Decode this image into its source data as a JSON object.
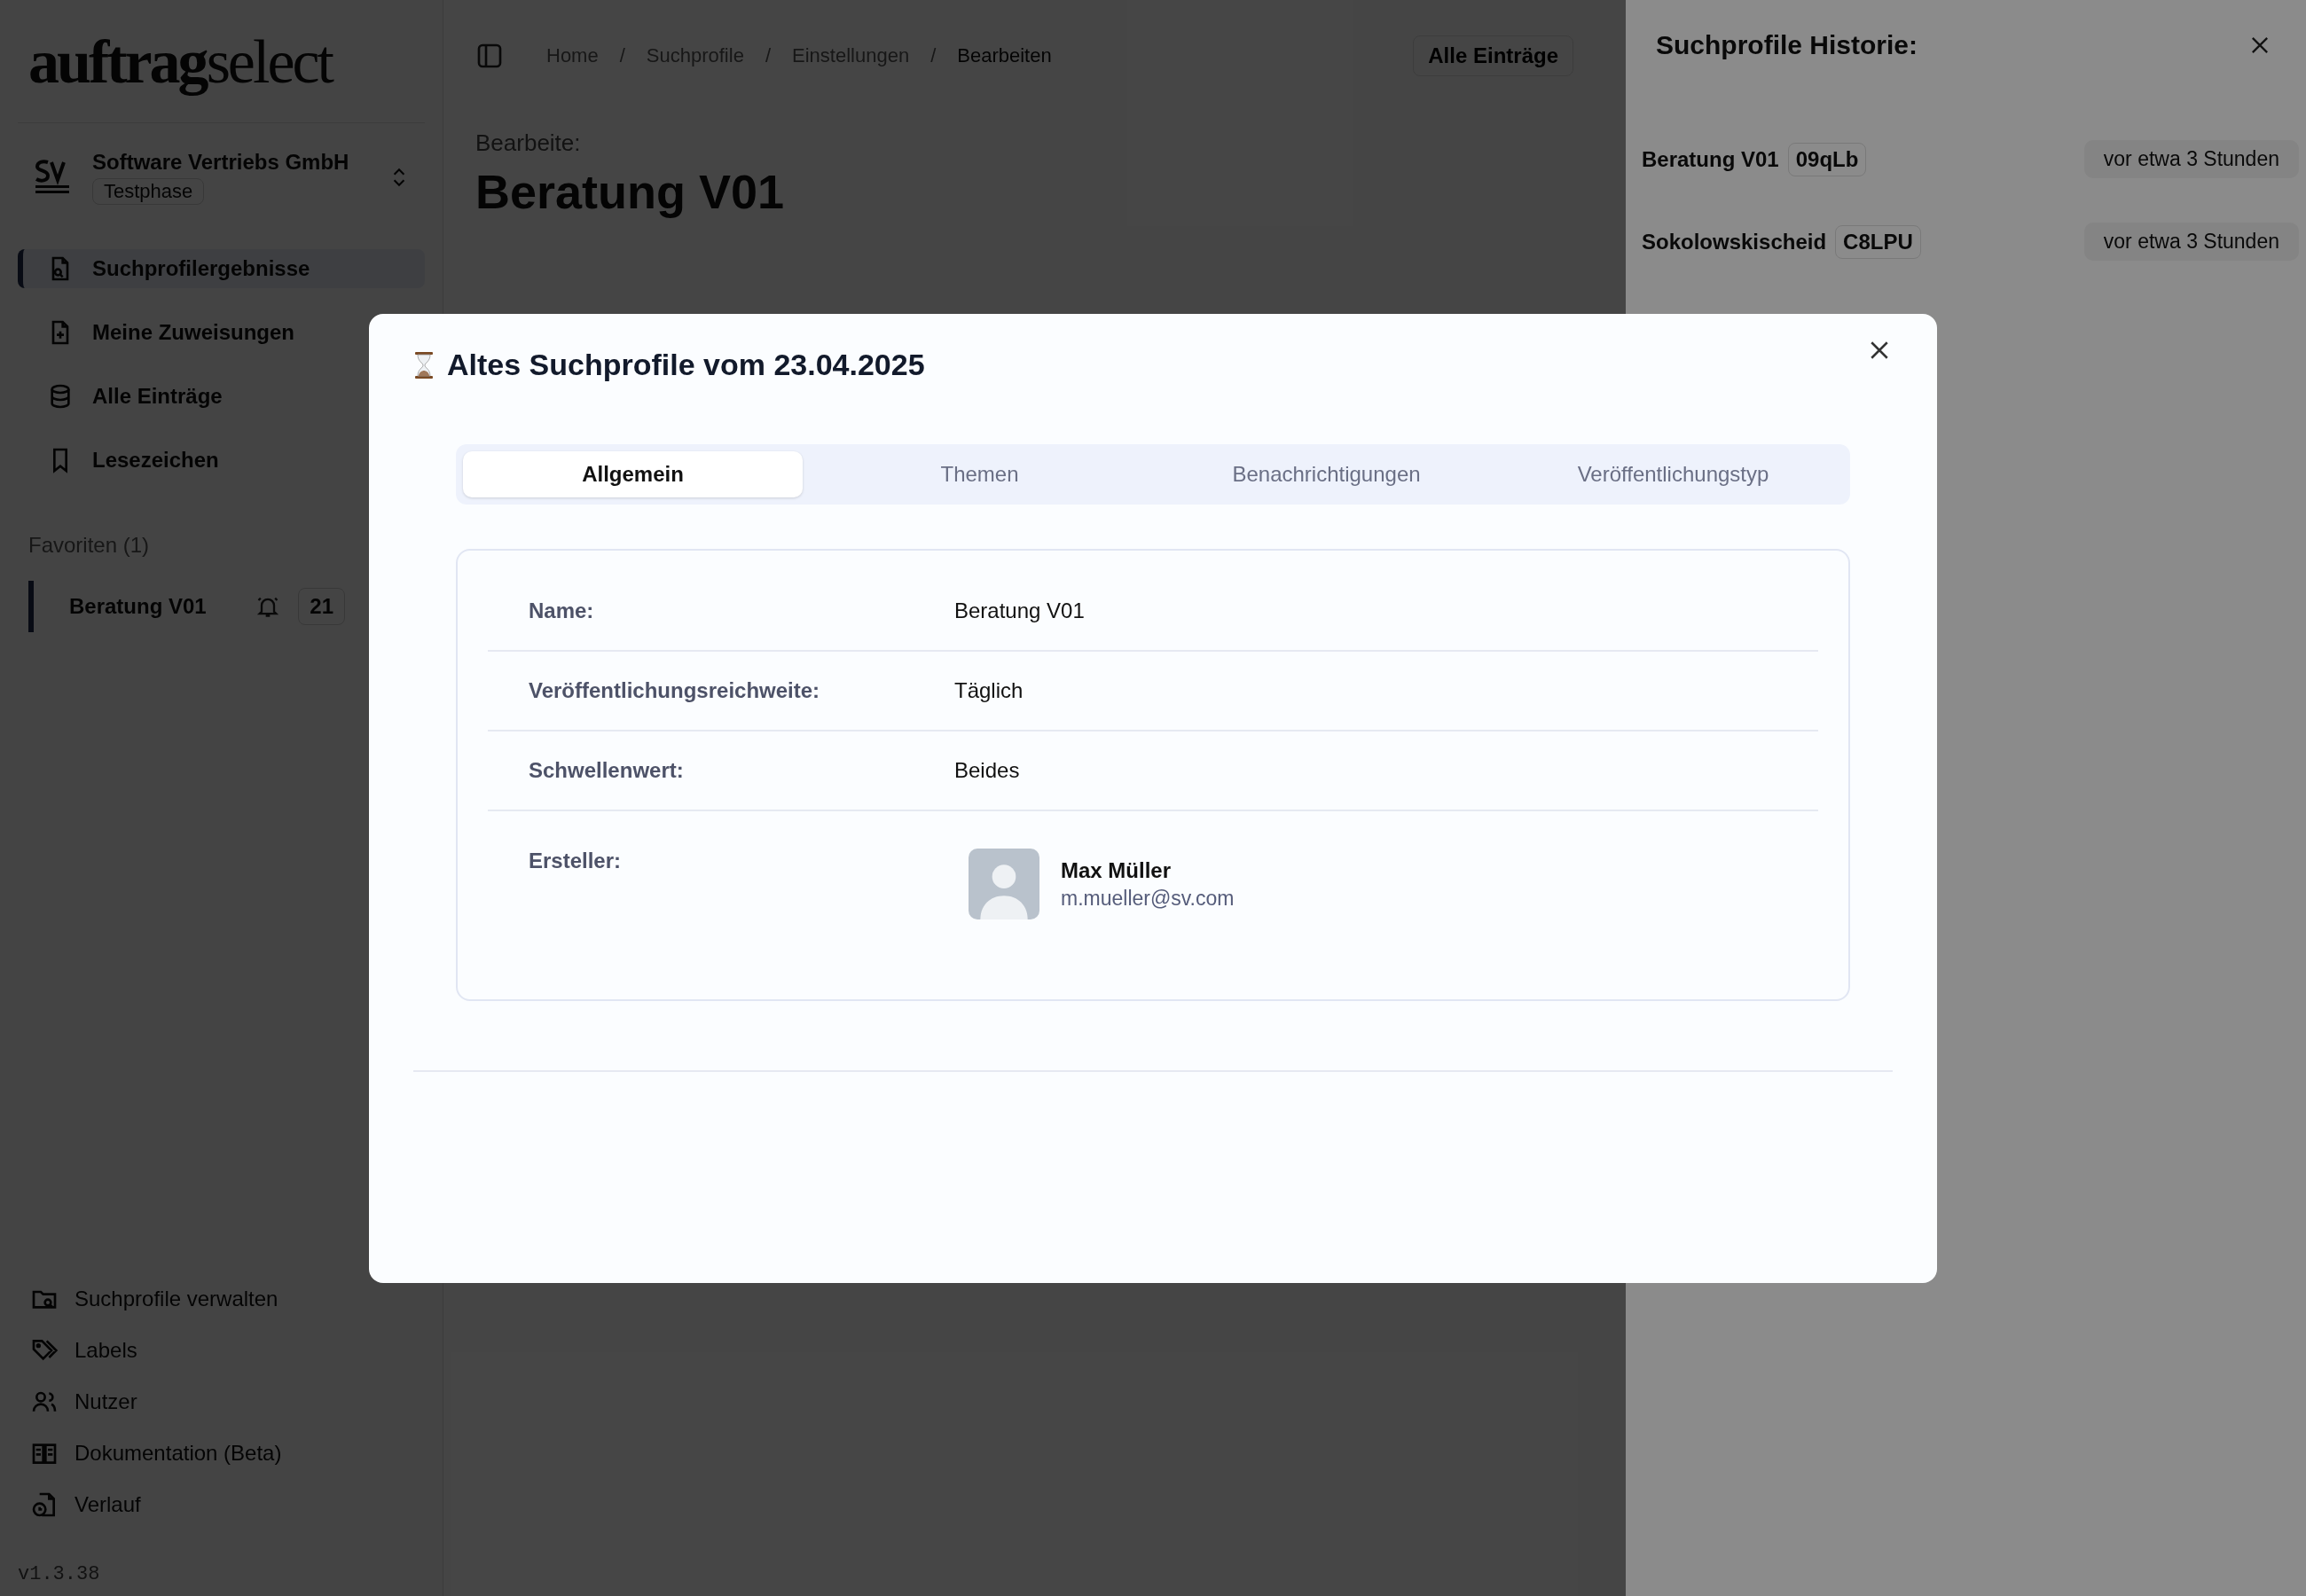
{
  "sidebar": {
    "logo": "**auftrag**select",
    "org": {
      "name": "Software Vertriebs GmbH",
      "badge": "Testphase"
    },
    "nav": [
      {
        "label": "Suchprofilergebnisse",
        "selected": true
      },
      {
        "label": "Meine Zuweisungen",
        "selected": false
      },
      {
        "label": "Alle Einträge",
        "selected": false
      },
      {
        "label": "Lesezeichen",
        "selected": false
      }
    ],
    "favorites_title": "Favoriten (1)",
    "favorites": [
      {
        "label": "Beratung V01",
        "count": "21"
      }
    ],
    "footer_nav": [
      {
        "label": "Suchprofile verwalten"
      },
      {
        "label": "Labels"
      },
      {
        "label": "Nutzer"
      },
      {
        "label": "Dokumentation (Beta)"
      },
      {
        "label": "Verlauf"
      }
    ],
    "version": "v1.3.38"
  },
  "main": {
    "breadcrumb": [
      "Home",
      "Suchprofile",
      "Einstellungen",
      "Bearbeiten"
    ],
    "separator": "/",
    "button": "Alle Einträge",
    "subtitle": "Bearbeite:",
    "title": "Beratung V01"
  },
  "history": {
    "title": "Suchprofile Historie:",
    "items": [
      {
        "name": "Beratung V01",
        "code": "09qLb",
        "time": "vor etwa 3 Stunden"
      },
      {
        "name": "Sokolowskischeid",
        "code": "C8LPU",
        "time": "vor etwa 3 Stunden"
      }
    ]
  },
  "modal": {
    "title": "Altes Suchprofile vom 23.04.2025",
    "tabs": [
      {
        "label": "Allgemein",
        "selected": true
      },
      {
        "label": "Themen",
        "selected": false
      },
      {
        "label": "Benachrichtigungen",
        "selected": false
      },
      {
        "label": "Veröffentlichungstyp",
        "selected": false
      }
    ],
    "fields": [
      {
        "kind": "text",
        "label": "Name:",
        "value": "Beratung V01"
      },
      {
        "kind": "text",
        "label": "Veröffentlichungsreichweite:",
        "value": "Täglich"
      },
      {
        "kind": "text",
        "label": "Schwellenwert:",
        "value": "Beides"
      },
      {
        "kind": "user",
        "label": "Ersteller:",
        "name": "Max Müller",
        "email": "m.mueller@sv.com"
      }
    ]
  }
}
